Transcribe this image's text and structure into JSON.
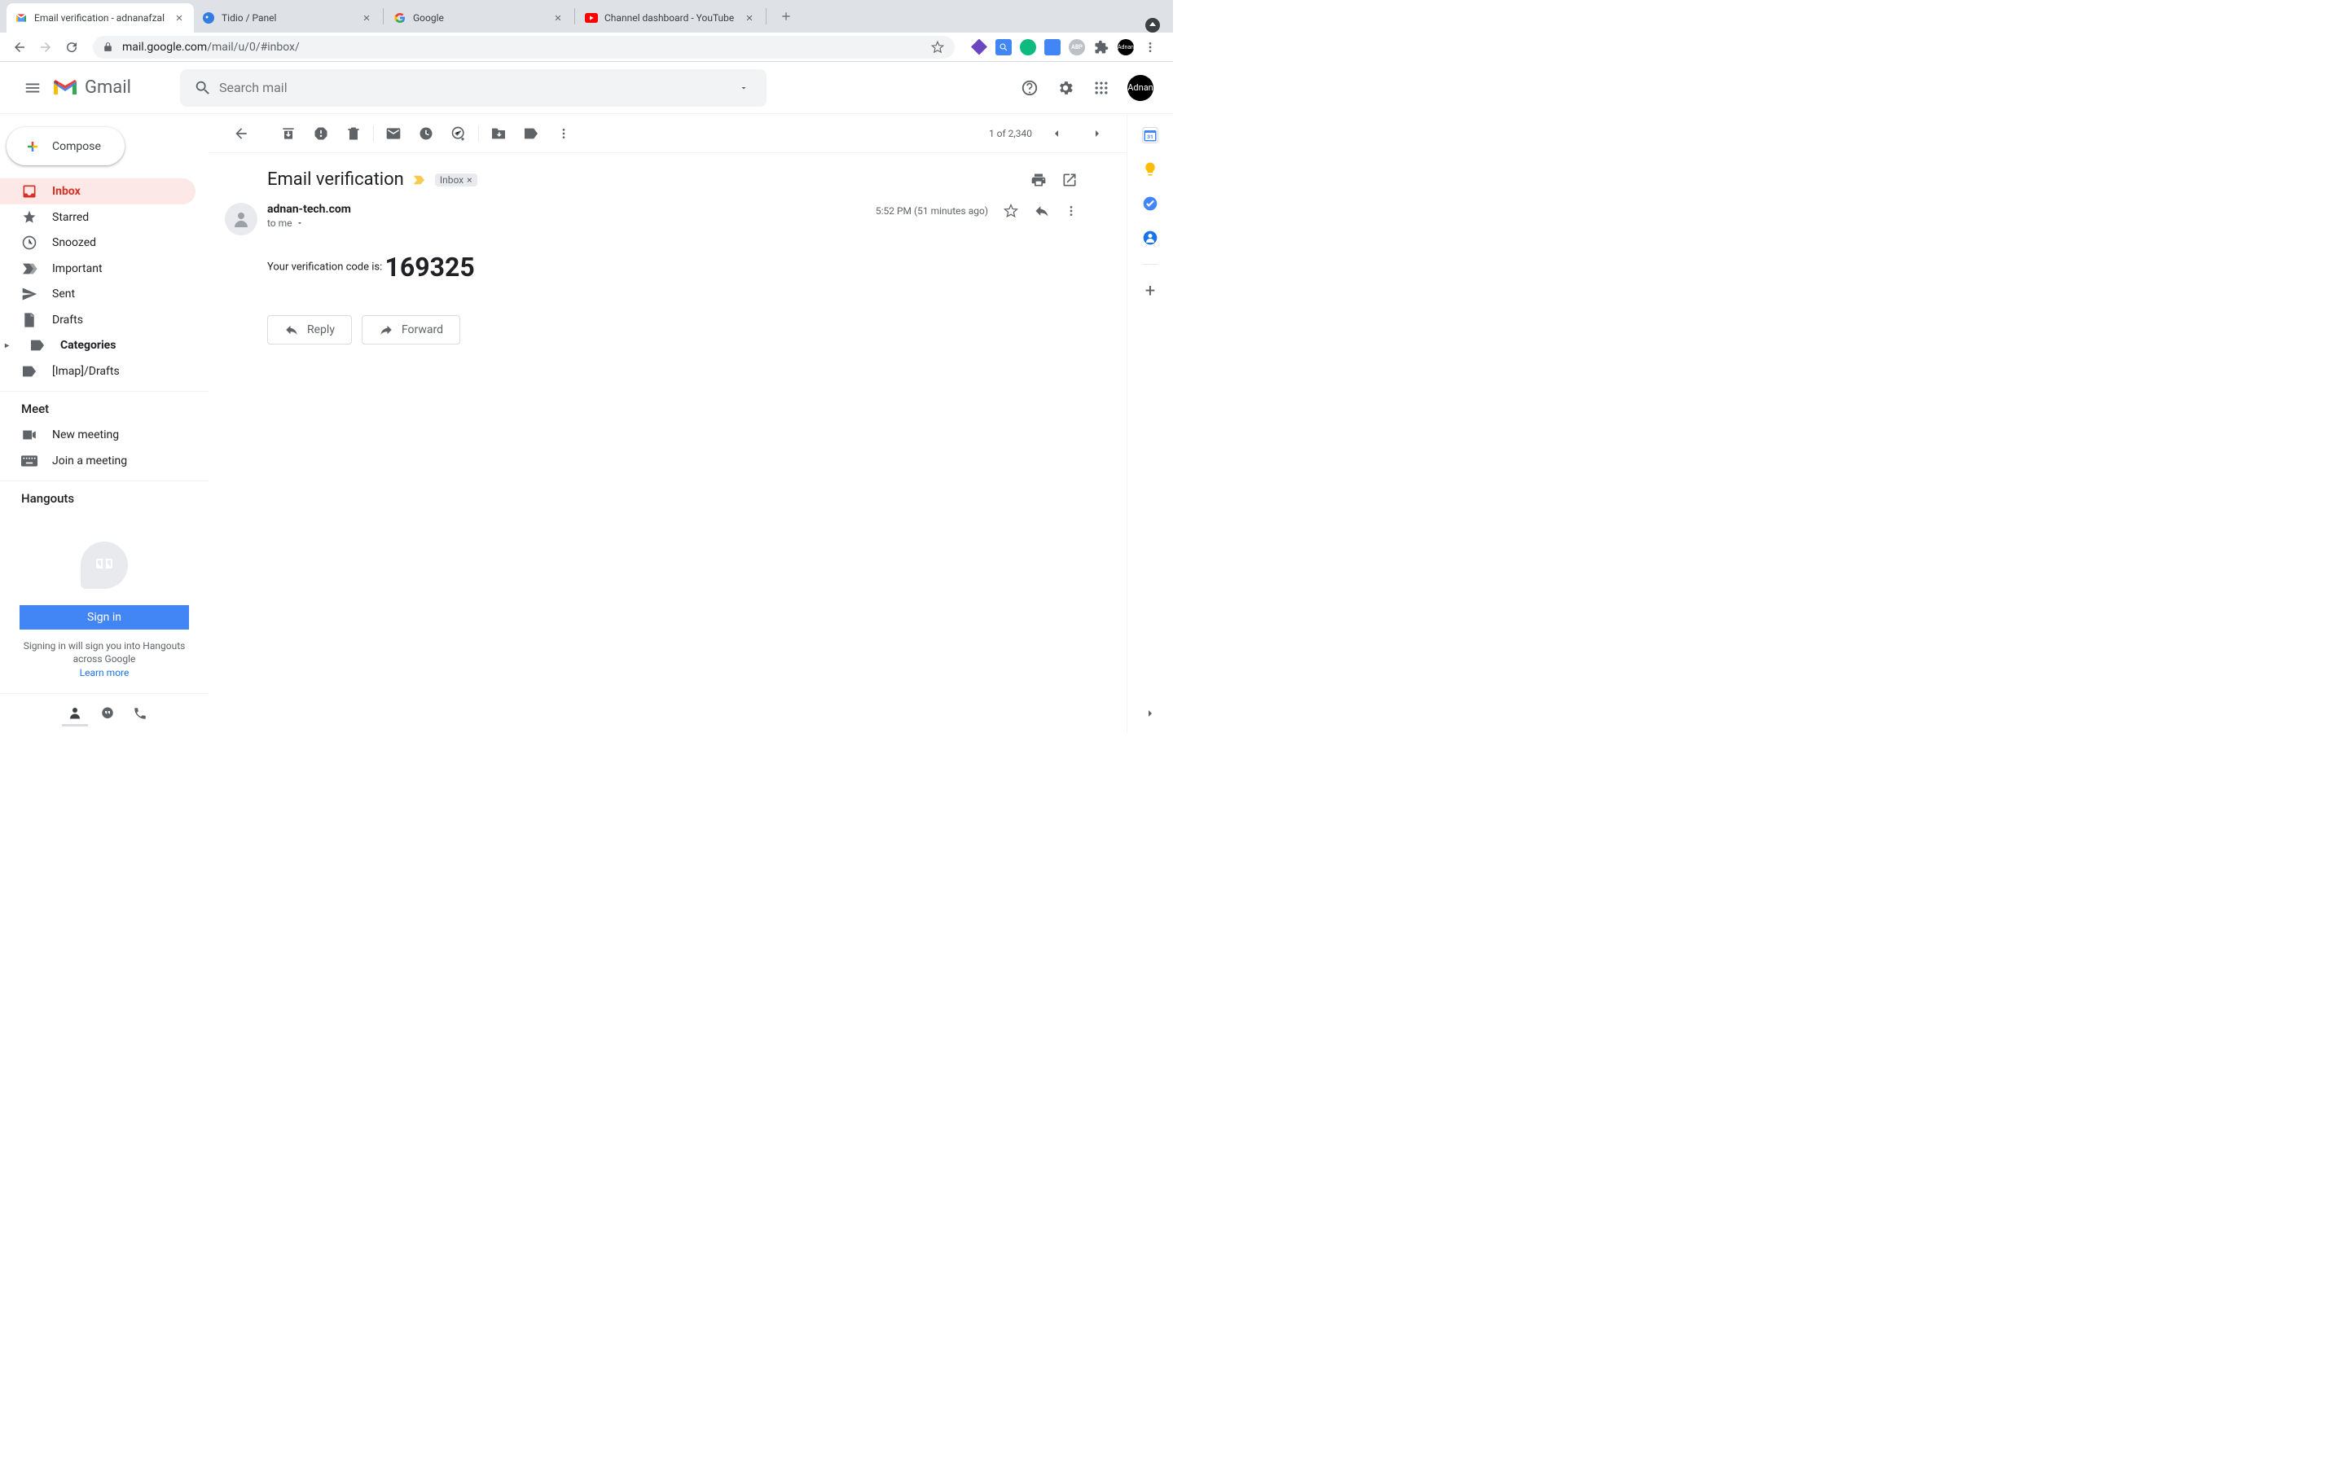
{
  "browser": {
    "tabs": [
      {
        "title": "Email verification - adnanafzal",
        "active": true,
        "favicon": "gmail"
      },
      {
        "title": "Tidio / Panel",
        "active": false,
        "favicon": "tidio"
      },
      {
        "title": "Google",
        "active": false,
        "favicon": "google"
      },
      {
        "title": "Channel dashboard - YouTube",
        "active": false,
        "favicon": "youtube"
      }
    ],
    "url_host": "mail.google.com",
    "url_path": "/mail/u/0/#inbox/",
    "profile_label": "Adnan"
  },
  "header": {
    "brand": "Gmail",
    "search_placeholder": "Search mail",
    "avatar_label": "Adnan"
  },
  "sidebar": {
    "compose": "Compose",
    "items": [
      {
        "label": "Inbox",
        "icon": "inbox",
        "active": true
      },
      {
        "label": "Starred",
        "icon": "star"
      },
      {
        "label": "Snoozed",
        "icon": "clock"
      },
      {
        "label": "Important",
        "icon": "important"
      },
      {
        "label": "Sent",
        "icon": "send"
      },
      {
        "label": "Drafts",
        "icon": "draft"
      },
      {
        "label": "Categories",
        "icon": "label",
        "bold": true,
        "expand": true
      },
      {
        "label": "[Imap]/Drafts",
        "icon": "label"
      }
    ],
    "meet_title": "Meet",
    "meet_items": [
      {
        "label": "New meeting",
        "icon": "video"
      },
      {
        "label": "Join a meeting",
        "icon": "keyboard"
      }
    ],
    "hangouts_title": "Hangouts",
    "signin_label": "Sign in",
    "signin_text": "Signing in will sign you into Hangouts across Google",
    "learn_more": "Learn more"
  },
  "toolbar": {
    "counter": "1 of 2,340"
  },
  "email": {
    "subject": "Email verification",
    "label": "Inbox",
    "sender": "adnan-tech.com",
    "recipient": "to me",
    "timestamp": "5:52 PM (51 minutes ago)",
    "body_prefix": "Your verification code is: ",
    "code": "169325",
    "reply_label": "Reply",
    "forward_label": "Forward"
  }
}
